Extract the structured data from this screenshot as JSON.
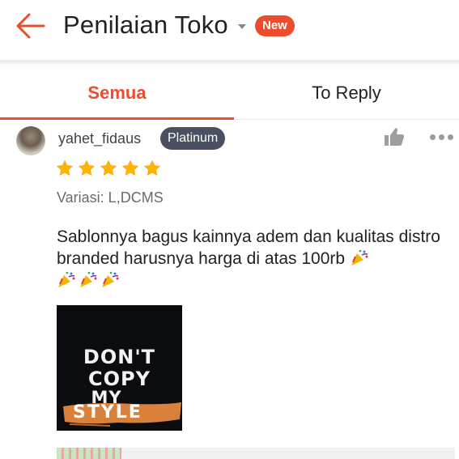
{
  "header": {
    "title": "Penilaian Toko",
    "badge": "New",
    "back_icon": "arrow-left-icon",
    "accent_color": "#ee4d2d"
  },
  "tabs": [
    {
      "label": "Semua",
      "active": true
    },
    {
      "label": "To Reply",
      "active": false
    }
  ],
  "review": {
    "username": "yahet_fidaus",
    "tier_badge": "Platinum",
    "rating": 5,
    "rating_max": 5,
    "variation": "Variasi: L,DCMS",
    "comment_text": "Sablonnya bagus kainnya adem dan kualitas distro branded harusnya harga di atas 100rb",
    "comment_emoji": "party-popper-icon",
    "emoji_count": 4,
    "photo_lines": [
      "DON'T",
      "COPY",
      "MY",
      "STYLE"
    ]
  }
}
